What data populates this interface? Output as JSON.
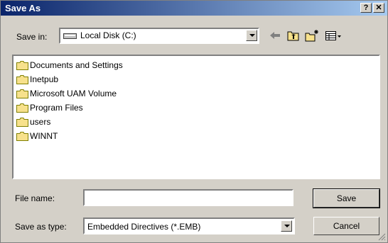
{
  "window": {
    "title": "Save As",
    "help_label": "?",
    "close_label": "✕"
  },
  "toolbar": {
    "save_in_label": "Save in:",
    "save_in_value": "Local Disk (C:)",
    "icons": [
      "drive-icon",
      "back-arrow-icon",
      "up-folder-icon",
      "new-folder-icon",
      "view-menu-icon"
    ]
  },
  "files": [
    {
      "name": "Documents and Settings"
    },
    {
      "name": "Inetpub"
    },
    {
      "name": "Microsoft UAM Volume"
    },
    {
      "name": "Program Files"
    },
    {
      "name": "users"
    },
    {
      "name": "WINNT"
    }
  ],
  "form": {
    "file_name_label": "File name:",
    "file_name_value": "",
    "save_as_type_label": "Save as type:",
    "save_as_type_value": "Embedded Directives (*.EMB)"
  },
  "buttons": {
    "save": "Save",
    "cancel": "Cancel"
  },
  "colors": {
    "title_start": "#0a246a",
    "title_end": "#a6caf0",
    "face": "#d4d0c8",
    "folder": "#f7e18c"
  }
}
